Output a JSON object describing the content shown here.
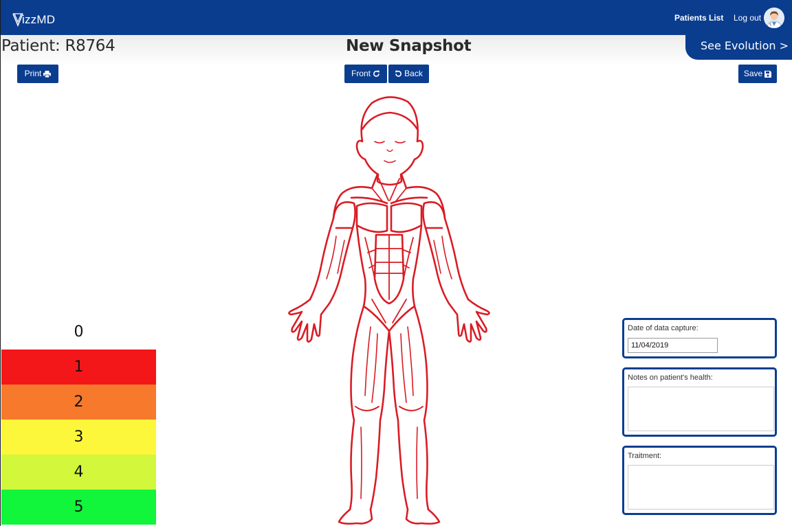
{
  "app": {
    "name": "VizzMD",
    "logo_text": "izzMD"
  },
  "nav": {
    "patients_list": "Patients List",
    "logout": "Log out"
  },
  "header": {
    "patient_title": "Patient: R8764",
    "page_title": "New Snapshot",
    "evolution_button": "See Evolution >"
  },
  "toolbar": {
    "print_label": "Print",
    "front_label": "Front",
    "back_label": "Back",
    "save_label": "Save"
  },
  "scale": {
    "levels": [
      {
        "label": "0",
        "color": "#ffffff"
      },
      {
        "label": "1",
        "color": "#f3171a"
      },
      {
        "label": "2",
        "color": "#f7792b"
      },
      {
        "label": "3",
        "color": "#fdf73b"
      },
      {
        "label": "4",
        "color": "#d2f73b"
      },
      {
        "label": "5",
        "color": "#11f53b"
      }
    ]
  },
  "form": {
    "date_label": "Date of data capture:",
    "date_value": "11/04/2019",
    "notes_label": "Notes on patient's health:",
    "notes_value": "",
    "treatment_label": "Traitment:",
    "treatment_value": ""
  },
  "colors": {
    "brand": "#0b3d8f",
    "body_outline": "#d91c24"
  },
  "icons": {
    "print": "print-icon",
    "front": "rotate-right-icon",
    "back": "rotate-left-icon",
    "save": "floppy-disk-icon",
    "avatar": "doctor-avatar"
  }
}
